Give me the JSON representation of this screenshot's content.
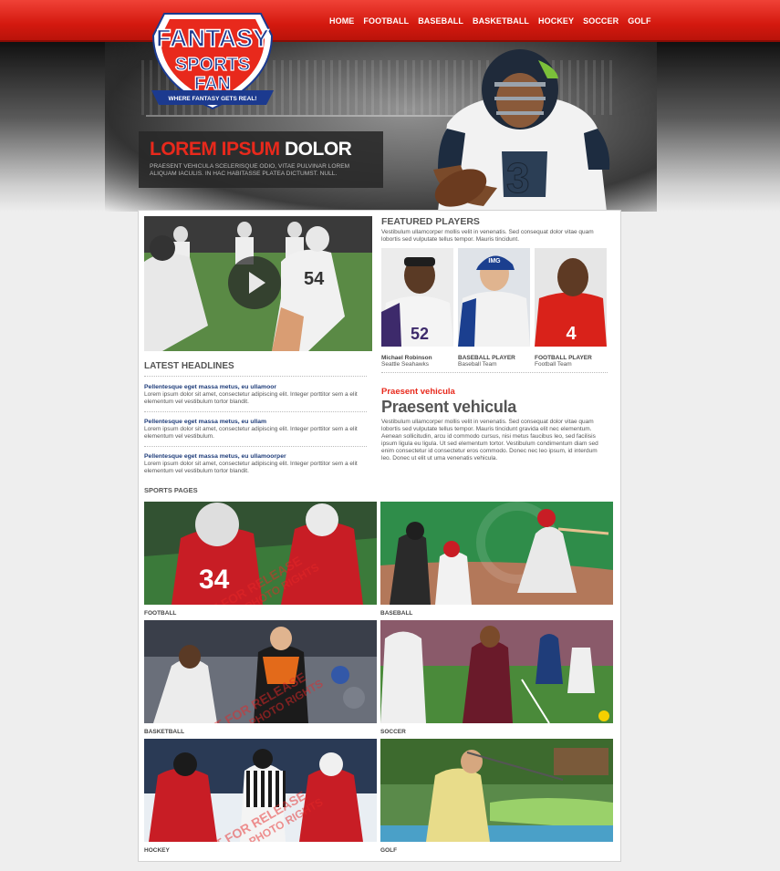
{
  "logo": {
    "line1": "FANTASY",
    "line2": "SPORTS",
    "line3": "FAN",
    "tagline": "WHERE FANTASY GETS REAL!"
  },
  "nav": [
    "HOME",
    "FOOTBALL",
    "BASEBALL",
    "BASKETBALL",
    "HOCKEY",
    "SOCCER",
    "GOLF"
  ],
  "hero": {
    "title_red": "LOREM IPSUM",
    "title_white": "DOLOR",
    "subtitle": "PRAESENT VEHICULA SCELERISQUE ODIO, VITAE PULVINAR LOREM ALIQUAM IACULIS. IN HAC HABITASSE PLATEA DICTUMST. NULL."
  },
  "latest": {
    "title": "LATEST HEADLINES",
    "items": [
      {
        "link": "Pellentesque eget massa metus, eu ullamoor",
        "text": "Lorem ipsum dolor sit amet, consectetur adipiscing elit. Integer porttitor sem a elit elementum vel vestibulum tortor blandit."
      },
      {
        "link": "Pellentesque eget massa metus, eu ullam",
        "text": "Lorem ipsum dolor sit amet, consectetur adipiscing elit. Integer porttitor sem a elit elementum vel vestibulum."
      },
      {
        "link": "Pellentesque eget massa metus, eu ullamoorper",
        "text": "Lorem ipsum dolor sit amet, consectetur adipiscing elit. Integer porttitor sem a elit elementum vel vestibulum tortor blandit."
      }
    ]
  },
  "featured": {
    "title": "FEATURED PLAYERS",
    "desc": "Vestibulum ullamcorper mollis velit in venenatis. Sed consequat dolor vitae quam lobortis sed vulputate tellus tempor. Mauris tincidunt.",
    "players": [
      {
        "name": "Michael Robinson",
        "team": "Seattle Seahawks"
      },
      {
        "name": "BASEBALL PLAYER",
        "team": "Baseball Team"
      },
      {
        "name": "FOOTBALL PLAYER",
        "team": "Football Team"
      }
    ]
  },
  "article": {
    "kicker": "Praesent vehicula",
    "title": "Praesent vehicula",
    "text": "Vestibulum ullamcorper mollis velit in venenatis. Sed consequat dolor vitae quam lobortis sed vulputate tellus tempor. Mauris tincidunt gravida elit nec elementum. Aenean sollicitudin, arcu id commodo cursus, nisi metus faucibus leo, sed facilisis ipsum ligula eu ligula. Ut sed elementum tortor. Vestibulum condimentum diam sed enim consectetur id consectetur eros commodo. Donec nec leo ipsum, id interdum leo. Donec ut elit ut uma venenatis vehicula."
  },
  "sports": {
    "title": "SPORTS PAGES",
    "tiles": [
      "FOOTBALL",
      "BASEBALL",
      "BASKETBALL",
      "SOCCER",
      "HOCKEY",
      "GOLF"
    ]
  },
  "watermark": {
    "line1": "NOT FOR RELEASE",
    "line2": "NEEDS PHOTO RIGHTS"
  },
  "colors": {
    "brand_red": "#e8291c",
    "headline_blue": "#1f3d7a",
    "logo_blue": "#1c3a8f"
  }
}
